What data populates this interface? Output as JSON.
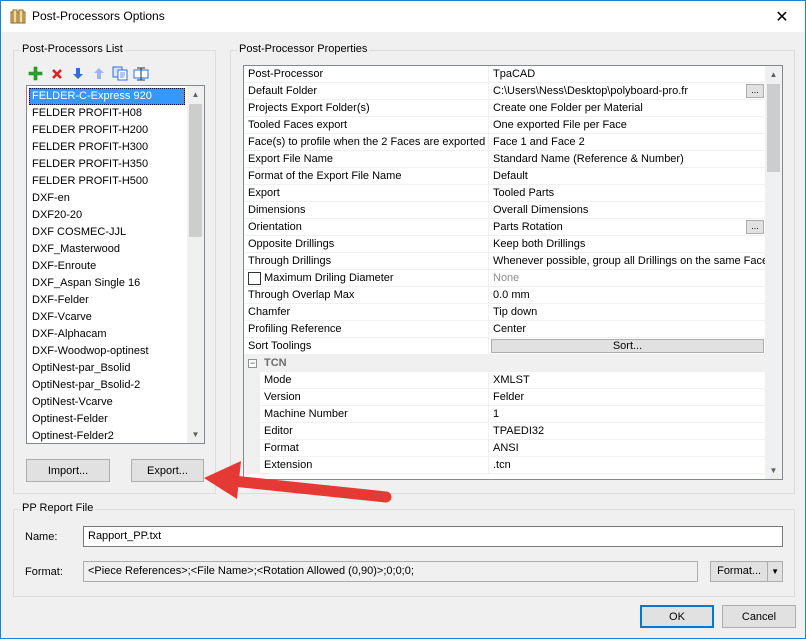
{
  "window": {
    "title": "Post-Processors Options",
    "close_glyph": "✕"
  },
  "left_panel": {
    "legend": "Post-Processors List",
    "toolbar": [
      {
        "icon": "add-icon",
        "color": "#2aa52a"
      },
      {
        "icon": "delete-icon",
        "color": "#e02020"
      },
      {
        "icon": "move-down-icon",
        "color": "#2f6fd8"
      },
      {
        "icon": "move-up-icon",
        "color": "#2f6fd8"
      },
      {
        "icon": "copy-icon",
        "color": "#2f6fd8"
      },
      {
        "icon": "rename-icon",
        "color": "#2f6fd8"
      }
    ],
    "items": [
      "FELDER-C-Express 920",
      "FELDER PROFIT-H08",
      "FELDER PROFIT-H200",
      "FELDER PROFIT-H300",
      "FELDER PROFIT-H350",
      "FELDER PROFIT-H500",
      "DXF-en",
      "DXF20-20",
      "DXF COSMEC-JJL",
      "DXF_Masterwood",
      "DXF-Enroute",
      "DXF_Aspan Single 16",
      "DXF-Felder",
      "DXF-Vcarve",
      "DXF-Alphacam",
      "DXF-Woodwop-optinest",
      "OptiNest-par_Bsolid",
      "OptiNest-par_Bsolid-2",
      "OptiNest-Vcarve",
      "Optinest-Felder",
      "Optinest-Felder2"
    ],
    "selected_index": 0,
    "import_label": "Import...",
    "export_label": "Export..."
  },
  "right_panel": {
    "legend": "Post-Processor Properties",
    "properties": [
      {
        "name": "Post-Processor",
        "value": "TpaCAD"
      },
      {
        "name": "Default Folder",
        "value": "C:\\Users\\Ness\\Desktop\\polyboard-pro.fr",
        "button": "..."
      },
      {
        "name": "Projects Export Folder(s)",
        "value": "Create one Folder per Material"
      },
      {
        "name": "Tooled Faces export",
        "value": "One exported File per Face"
      },
      {
        "name": "Face(s) to profile when the 2 Faces are exported",
        "value": "Face 1 and Face 2"
      },
      {
        "name": "Export File Name",
        "value": "Standard Name (Reference & Number)"
      },
      {
        "name": "Format of the Export File Name",
        "value": "Default"
      },
      {
        "name": "Export",
        "value": "Tooled Parts"
      },
      {
        "name": "Dimensions",
        "value": "Overall Dimensions"
      },
      {
        "name": "Orientation",
        "value": "Parts Rotation",
        "button": "..."
      },
      {
        "name": "Opposite Drillings",
        "value": "Keep both Drillings"
      },
      {
        "name": "Through Drillings",
        "value": "Whenever possible, group all Drillings on the same Face"
      },
      {
        "name": "Maximum Driling Diameter",
        "value": "None",
        "checkbox": true,
        "disabled": true
      },
      {
        "name": "Through Overlap Max",
        "value": "0.0 mm"
      },
      {
        "name": "Chamfer",
        "value": "Tip down"
      },
      {
        "name": "Profiling Reference",
        "value": "Center"
      },
      {
        "name": "Sort Toolings",
        "sort_button": "Sort..."
      }
    ],
    "category": {
      "name": "TCN",
      "toggle": "−"
    },
    "sub_properties": [
      {
        "name": "Mode",
        "value": "XMLST"
      },
      {
        "name": "Version",
        "value": "Felder"
      },
      {
        "name": "Machine Number",
        "value": "1"
      },
      {
        "name": "Editor",
        "value": "TPAEDI32"
      },
      {
        "name": "Format",
        "value": "ANSI"
      },
      {
        "name": "Extension",
        "value": ".tcn"
      }
    ]
  },
  "report": {
    "legend": "PP Report File",
    "name_label": "Name:",
    "name_value": "Rapport_PP.txt",
    "format_label": "Format:",
    "format_value": "<Piece References>;<File Name>;<Rotation Allowed (0,90)>;0;0;0;",
    "format_button": "Format..."
  },
  "footer": {
    "ok_label": "OK",
    "cancel_label": "Cancel"
  },
  "annotation": {
    "arrow_color": "#e53935"
  }
}
